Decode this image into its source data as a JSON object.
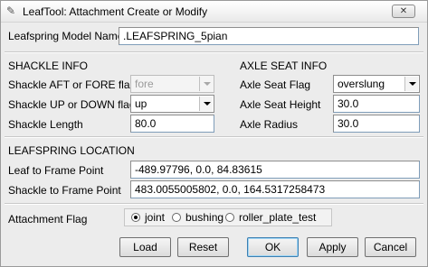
{
  "window": {
    "title": "LeafTool: Attachment Create or Modify",
    "close_label": "✕"
  },
  "model": {
    "label": "Leafspring Model Name",
    "value": ".LEAFSPRING_5pian"
  },
  "shackle": {
    "header": "SHACKLE INFO",
    "aft_fore_label": "Shackle AFT or FORE flag",
    "aft_fore_value": "fore",
    "up_down_label": "Shackle UP or DOWN flag",
    "up_down_value": "up",
    "length_label": "Shackle Length",
    "length_value": "80.0"
  },
  "axle": {
    "header": "AXLE SEAT INFO",
    "flag_label": "Axle Seat Flag",
    "flag_value": "overslung",
    "height_label": "Axle Seat Height",
    "height_value": "30.0",
    "radius_label": "Axle Radius",
    "radius_value": "30.0"
  },
  "location": {
    "header": "LEAFSPRING LOCATION",
    "leaf_label": "Leaf to Frame Point",
    "leaf_value": "-489.97796, 0.0, 84.83615",
    "shackle_label": "Shackle to Frame Point",
    "shackle_value": "483.0055005802, 0.0, 164.5317258473"
  },
  "attachment": {
    "label": "Attachment Flag",
    "options": [
      "joint",
      "bushing",
      "roller_plate_test"
    ],
    "selected": "joint"
  },
  "buttons": {
    "load": "Load",
    "reset": "Reset",
    "ok": "OK",
    "apply": "Apply",
    "cancel": "Cancel"
  }
}
